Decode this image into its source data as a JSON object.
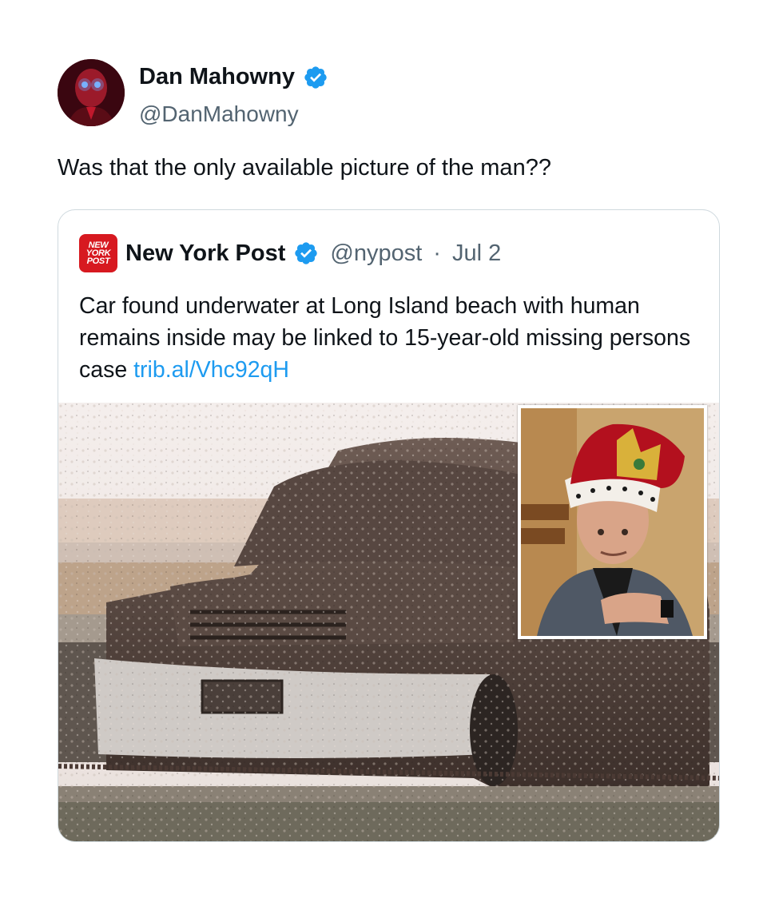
{
  "tweet": {
    "author": {
      "name": "Dan Mahowny",
      "handle": "@DanMahowny",
      "verified": true
    },
    "text": "Was that the only available picture of the man??"
  },
  "quote": {
    "logo_lines": [
      "NEW",
      "YORK",
      "POST"
    ],
    "author": "New York Post",
    "handle": "@nypost",
    "separator": "·",
    "date": "Jul 2",
    "verified": true,
    "text": "Car found underwater at Long Island beach with human remains inside may be linked to 15-year-old missing persons case",
    "link": "trib.al/Vhc92qH"
  },
  "colors": {
    "verified_blue": "#1d9bf0",
    "link_blue": "#1d9bf0",
    "nypost_red": "#d71920",
    "secondary_text": "#536471"
  },
  "icons": {
    "verified": "verified-badge-icon"
  }
}
